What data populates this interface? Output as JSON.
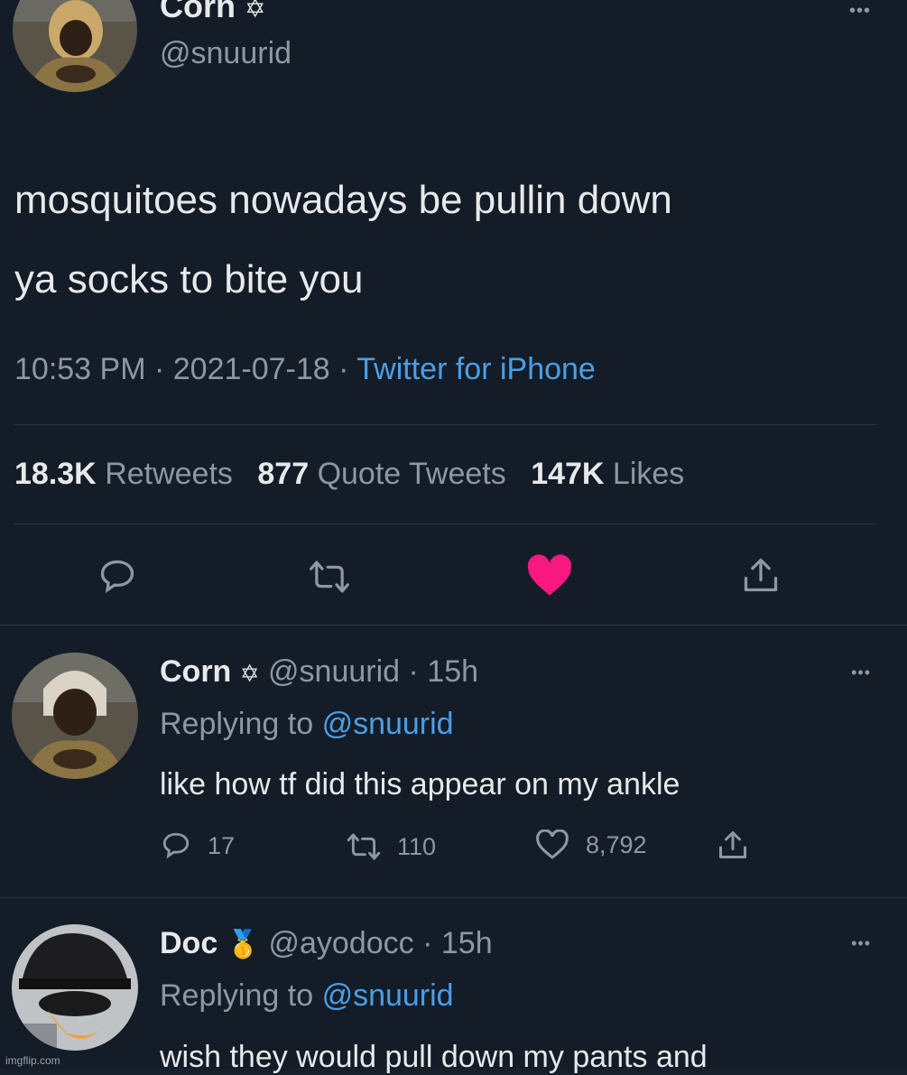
{
  "main_tweet": {
    "display_name": "Corn",
    "name_badge": "✡",
    "handle": "@snuurid",
    "text_line1": "mosquitoes nowadays be pullin down",
    "text_line2": "ya socks to bite you",
    "time": "10:53 PM",
    "sep1": " · ",
    "date": "2021-07-18",
    "sep2": " · ",
    "source": "Twitter for iPhone",
    "stats": {
      "retweets_count": "18.3K",
      "retweets_label": "Retweets",
      "quotes_count": "877",
      "quotes_label": "Quote Tweets",
      "likes_count": "147K",
      "likes_label": "Likes"
    },
    "more": "•••"
  },
  "replies": [
    {
      "display_name": "Corn",
      "name_badge": "✡",
      "handle": "@snuurid",
      "age": "· 15h",
      "replying_prefix": "Replying to",
      "replying_handle": "@snuurid",
      "text": "like how tf did this appear on my ankle",
      "replies_count": "17",
      "retweets_count": "110",
      "likes_count": "8,792",
      "more": "•••"
    },
    {
      "display_name": "Doc",
      "name_badge": "🥇",
      "handle": "@ayodocc",
      "age": "· 15h",
      "replying_prefix": "Replying to",
      "replying_handle": "@snuurid",
      "text": "wish they would pull down my pants and",
      "more": "•••"
    }
  ],
  "watermark": "imgflip.com",
  "colors": {
    "background": "#141c27",
    "like_active": "#f91880",
    "link": "#4a9fe8",
    "muted": "#8b98a5"
  },
  "icons": {
    "reply": "reply-icon",
    "retweet": "retweet-icon",
    "like": "heart-icon",
    "share": "share-icon"
  }
}
